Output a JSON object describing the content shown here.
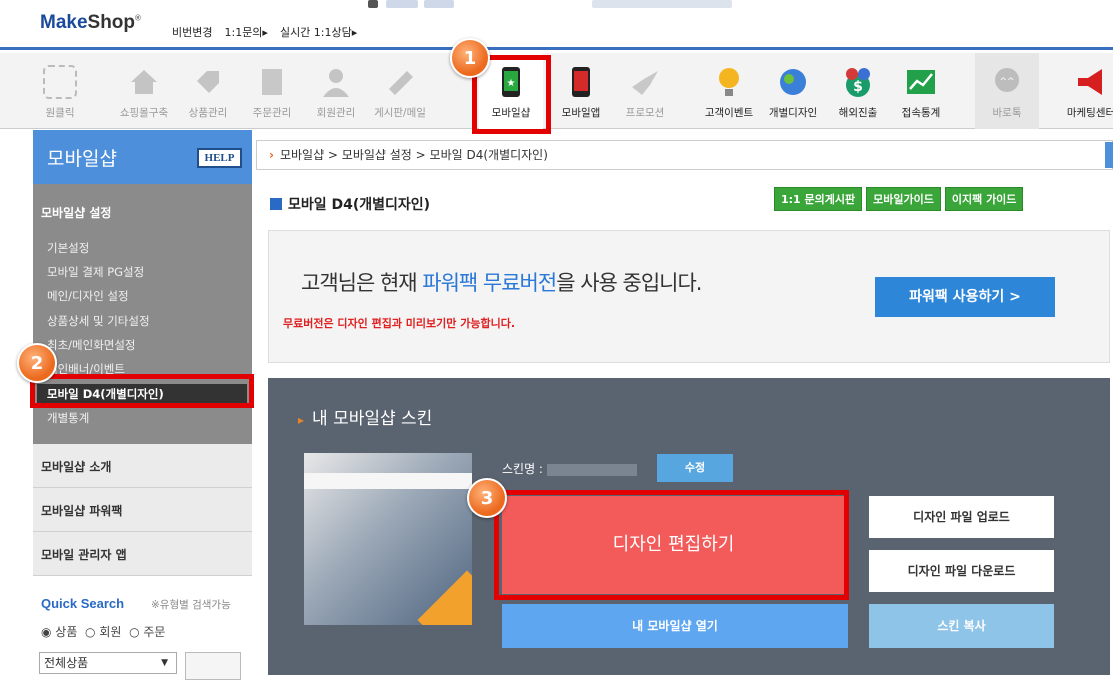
{
  "header": {
    "logo_make": "Make",
    "logo_shop": "Shop",
    "logo_mark": "®",
    "links": [
      "비번변경",
      "1:1문의▸",
      "실시간 1:1상담▸"
    ]
  },
  "toolbar": {
    "items": [
      {
        "label": "원클릭",
        "icon": "one-click-icon"
      },
      {
        "label": "쇼핑몰구축",
        "icon": "home-icon"
      },
      {
        "label": "상품관리",
        "icon": "tag-icon"
      },
      {
        "label": "주문관리",
        "icon": "won-document-icon"
      },
      {
        "label": "회원관리",
        "icon": "member-icon"
      },
      {
        "label": "게시판/메일",
        "icon": "board-mail-icon"
      },
      {
        "label": "모바일샵",
        "icon": "mobile-shop-icon"
      },
      {
        "label": "모바일앱",
        "icon": "mobile-app-icon"
      },
      {
        "label": "프로모션",
        "icon": "promotion-bird-icon"
      },
      {
        "label": "고객이벤트",
        "icon": "lightbulb-icon"
      },
      {
        "label": "개별디자인",
        "icon": "chameleon-icon"
      },
      {
        "label": "해외진출",
        "icon": "currency-icon"
      },
      {
        "label": "접속통계",
        "icon": "stats-chart-icon"
      },
      {
        "label": "바로톡",
        "icon": "chat-icon"
      },
      {
        "label": "마케팅센터",
        "icon": "megaphone-icon"
      }
    ]
  },
  "badges": [
    "1",
    "2",
    "3"
  ],
  "sidebar": {
    "title": "모바일샵",
    "help": "HELP",
    "section_title": "모바일샵 설정",
    "items": [
      "기본설정",
      "모바일 결제 PG설정",
      "메인/디자인 설정",
      "상품상세 및 기타설정",
      "최초/메인화면설정",
      "메인배너/이벤트",
      "모바일 D4(개별디자인)",
      "개별통계"
    ],
    "menus": [
      "모바일샵 소개",
      "모바일샵 파워팩",
      "모바일 관리자 앱"
    ],
    "quick_search": {
      "title": "Quick Search",
      "note": "※유형별 검색가능",
      "radios": [
        "상품",
        "회원",
        "주문"
      ],
      "select": "전체상품"
    }
  },
  "main": {
    "breadcrumb": "모바일샵 > 모바일샵 설정 > 모바일 D4(개별디자인)",
    "title": "모바일 D4(개별디자인)",
    "guide_buttons": [
      "1:1 문의게시판",
      "모바일가이드",
      "이지팩 가이드"
    ],
    "promo": {
      "prefix": "고객님은 현재 ",
      "highlight": "파워팩 무료버전",
      "suffix": "을 사용 중입니다.",
      "sub": "무료버전은 디자인 편집과 미리보기만 가능합니다.",
      "button": "파워팩 사용하기 >"
    },
    "skin": {
      "heading": "내 모바일샵 스킨",
      "name_label": "스킨명 :",
      "modify": "수정",
      "edit": "디자인 편집하기",
      "upload": "디자인 파일 업로드",
      "download": "디자인 파일 다운로드",
      "open": "내 모바일샵 열기",
      "copy": "스킨 복사"
    }
  },
  "colors": {
    "accent": "#4d8fda",
    "highlight_box": "#e30000",
    "edit_button": "#f35a5a",
    "badge": "#ec6a1e"
  }
}
